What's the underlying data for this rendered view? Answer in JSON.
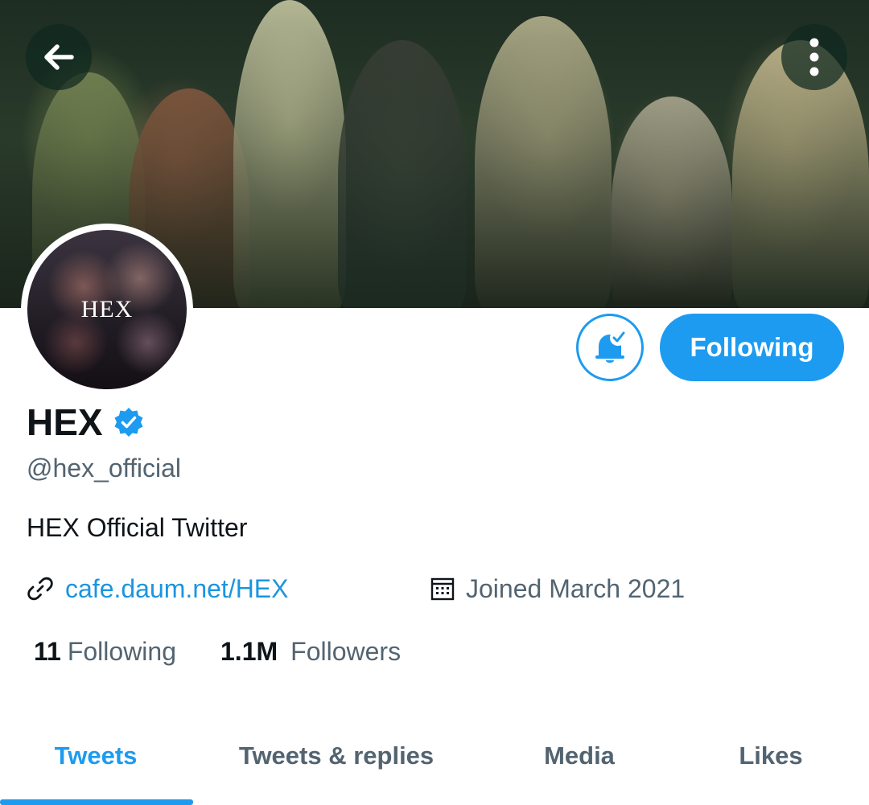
{
  "header": {
    "back_icon": "arrow-left-icon",
    "more_icon": "more-vertical-icon"
  },
  "profile": {
    "avatar_text": "HEX",
    "name": "HEX",
    "verified_icon": "verified-badge-icon",
    "handle": "@hex_official",
    "bio": "HEX Official Twitter",
    "website": "cafe.daum.net/HEX",
    "joined": "Joined March 2021"
  },
  "actions": {
    "notifications_icon": "bell-check-icon",
    "follow_label": "Following"
  },
  "stats": {
    "following_count": "11",
    "following_label": "Following",
    "followers_count": "1.1M",
    "followers_label": "Followers"
  },
  "tabs": [
    {
      "label": "Tweets",
      "active": true
    },
    {
      "label": "Tweets & replies",
      "active": false
    },
    {
      "label": "Media",
      "active": false
    },
    {
      "label": "Likes",
      "active": false
    }
  ],
  "colors": {
    "accent": "#1d9bf0",
    "link": "#1b95e0",
    "secondary_text": "#536471",
    "primary_text": "#0f1419"
  }
}
